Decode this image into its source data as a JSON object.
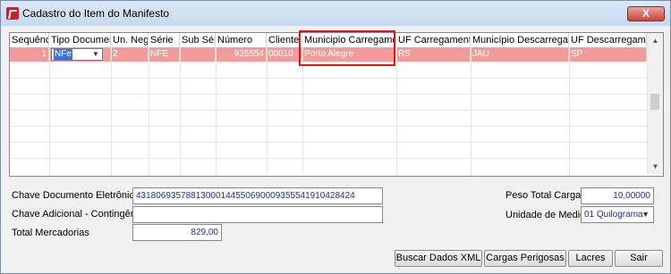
{
  "window": {
    "title": "Cadastro do Item do Manifesto",
    "close_label": "X"
  },
  "grid": {
    "columns": [
      "Sequência",
      "Tipo Documento",
      "Un. Neg.",
      "Série",
      "Sub Série",
      "Número",
      "Cliente",
      "Municipio Carregamento",
      "UF Carregamento",
      "Município Descarregamento",
      "UF Descarregamento"
    ],
    "rows": [
      {
        "sequencia": "1",
        "tipo_documento": "NFe",
        "un_neg": "2",
        "serie": "NFE",
        "sub_serie": "",
        "numero": "935554",
        "cliente": "00010",
        "municipio_carregamento": "Porto Alegre",
        "uf_carregamento": "RS",
        "municipio_descarregamento": "JAU",
        "uf_descarregamento": "SP"
      }
    ]
  },
  "form": {
    "chave_documento_label": "Chave Documento Eletrônico",
    "chave_documento_value": "43180693578813000144550690009355541910428424",
    "chave_adicional_label": "Chave Adicional - Contingência FS",
    "chave_adicional_value": "",
    "total_mercadorias_label": "Total Mercadorias",
    "total_mercadorias_value": "829,00",
    "peso_total_label": "Peso Total Carga",
    "peso_total_value": "10,00000",
    "unidade_medida_label": "Unidade de Medida",
    "unidade_medida_value": "01 Quilograma"
  },
  "buttons": {
    "buscar_xml": "Buscar Dados XML",
    "cargas_perigosas": "Cargas Perigosas",
    "lacres": "Lacres",
    "sair": "Sair"
  }
}
